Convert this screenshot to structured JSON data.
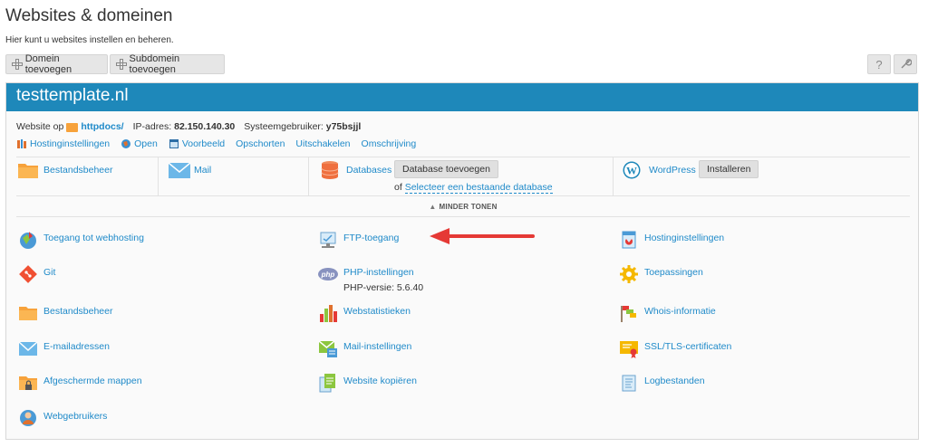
{
  "page": {
    "title": "Websites & domeinen",
    "subtitle": "Hier kunt u websites instellen en beheren."
  },
  "toolbar": {
    "add_domain": "Domein toevoegen",
    "add_subdomain": "Subdomein toevoegen",
    "help_icon": "help-icon",
    "tools_icon": "wrench-icon"
  },
  "domain": {
    "name": "testtemplate.nl",
    "website_prefix": "Website op",
    "docroot": "httpdocs/",
    "ip_label": "IP-adres:",
    "ip_value": "82.150.140.30",
    "sysuser_label": "Systeemgebruiker:",
    "sysuser_value": "y75bsjjl"
  },
  "actions": [
    {
      "label": "Hostinginstellingen",
      "icon": "hosting-settings-icon"
    },
    {
      "label": "Open",
      "icon": "open-globe-icon"
    },
    {
      "label": "Voorbeeld",
      "icon": "preview-icon"
    },
    {
      "label": "Opschorten"
    },
    {
      "label": "Uitschakelen"
    },
    {
      "label": "Omschrijving"
    }
  ],
  "quick": {
    "filemanager": "Bestandsbeheer",
    "mail": "Mail",
    "databases": "Databases",
    "add_database": "Database toevoegen",
    "or": "of",
    "select_database": "Selecteer een bestaande database",
    "wordpress": "WordPress",
    "install": "Installeren"
  },
  "less_toggle": "MINDER TONEN",
  "tools": {
    "col1": [
      {
        "label": "Toegang tot webhosting",
        "icon": "webhosting-access-icon"
      },
      {
        "label": "Git",
        "icon": "git-icon"
      },
      {
        "label": "Bestandsbeheer",
        "icon": "folder-icon"
      },
      {
        "label": "E-mailadressen",
        "icon": "mail-envelope-icon"
      },
      {
        "label": "Afgeschermde mappen",
        "icon": "locked-folder-icon"
      },
      {
        "label": "Webgebruikers",
        "icon": "web-users-icon"
      }
    ],
    "col2": [
      {
        "label": "FTP-toegang",
        "icon": "ftp-access-icon"
      },
      {
        "label": "PHP-instellingen",
        "icon": "php-icon",
        "sub": "PHP-versie: 5.6.40"
      },
      {
        "label": "Webstatistieken",
        "icon": "statistics-icon"
      },
      {
        "label": "Mail-instellingen",
        "icon": "mail-settings-icon"
      },
      {
        "label": "Website kopiëren",
        "icon": "copy-website-icon"
      }
    ],
    "col3": [
      {
        "label": "Hostinginstellingen",
        "icon": "hosting-settings-doc-icon"
      },
      {
        "label": "Toepassingen",
        "icon": "applications-gear-icon"
      },
      {
        "label": "Whois-informatie",
        "icon": "whois-flags-icon"
      },
      {
        "label": "SSL/TLS-certificaten",
        "icon": "certificate-icon"
      },
      {
        "label": "Logbestanden",
        "icon": "log-files-icon"
      }
    ]
  },
  "colors": {
    "header_blue": "#1e88ba",
    "link_blue": "#1f8ac9",
    "arrow_red": "#e53935",
    "folder_orange": "#f7a23b"
  }
}
